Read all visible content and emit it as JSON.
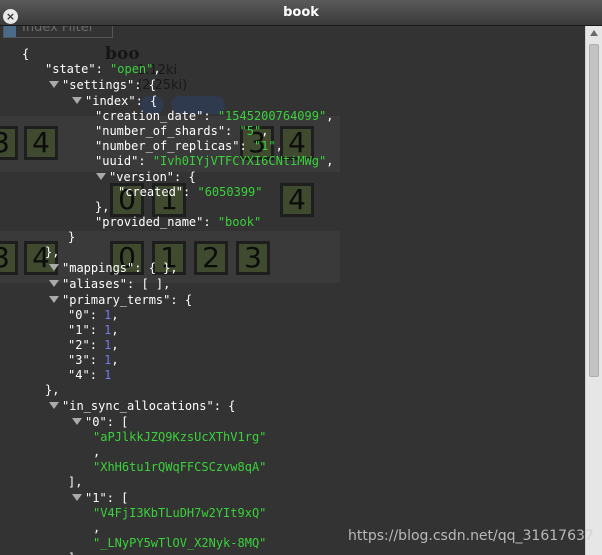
{
  "window": {
    "title": "book"
  },
  "background": {
    "filter_placeholder": "Index Filter",
    "index_name": "boo",
    "index_size": "1.12ki (2.25ki)",
    "shard_numbers": [
      "3",
      "4",
      "3",
      "4",
      "0",
      "1",
      "4",
      "3",
      "4",
      "0",
      "1",
      "2",
      "3"
    ]
  },
  "json": {
    "state_key": "\"state\"",
    "state_val": "\"open\"",
    "settings_key": "\"settings\"",
    "index_key": "\"index\"",
    "creation_date_key": "\"creation_date\"",
    "creation_date_val": "\"1545200764099\"",
    "shards_key": "\"number_of_shards\"",
    "shards_val": "\"5\"",
    "replicas_key": "\"number_of_replicas\"",
    "replicas_val": "\"1\"",
    "uuid_key": "\"uuid\"",
    "uuid_val": "\"Ivh0IYjVTFCYXI6CNtiMWg\"",
    "version_key": "\"version\"",
    "created_key": "\"created\"",
    "created_val": "\"6050399\"",
    "provided_name_key": "\"provided_name\"",
    "provided_name_val": "\"book\"",
    "mappings_key": "\"mappings\"",
    "aliases_key": "\"aliases\"",
    "primary_terms_key": "\"primary_terms\"",
    "pt": [
      {
        "k": "\"0\"",
        "v": "1"
      },
      {
        "k": "\"1\"",
        "v": "1"
      },
      {
        "k": "\"2\"",
        "v": "1"
      },
      {
        "k": "\"3\"",
        "v": "1"
      },
      {
        "k": "\"4\"",
        "v": "1"
      }
    ],
    "in_sync_key": "\"in_sync_allocations\"",
    "alloc_0_key": "\"0\"",
    "alloc_0_vals": [
      "\"aPJlkkJZQ9KzsUcXThV1rg\"",
      "\"XhH6tu1rQWqFFCSCzvw8qA\""
    ],
    "alloc_1_key": "\"1\"",
    "alloc_1_vals": [
      "\"V4FjI3KbTLuDH7w2YIt9xQ\"",
      "\"_LNyPY5wTlOV_X2Nyk-8MQ\""
    ]
  },
  "watermark": "https://blog.csdn.net/qq_31617637"
}
